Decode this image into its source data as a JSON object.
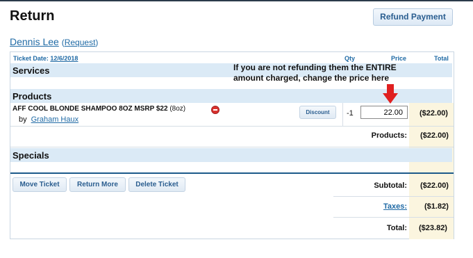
{
  "page": {
    "title": "Return"
  },
  "header": {
    "refund_button": "Refund Payment"
  },
  "customer": {
    "name": "Dennis Lee",
    "request_link": "Request"
  },
  "ticket": {
    "date_label": "Ticket Date:",
    "date_value": "12/6/2018",
    "col_qty": "Qty",
    "col_price": "Price",
    "col_total": "Total"
  },
  "sections": {
    "services": "Services",
    "products": "Products",
    "specials": "Specials"
  },
  "annotation": {
    "line1": "If you are not refunding them the ENTIRE",
    "line2": "amount charged, change the price here",
    "arrow_color": "#e02020"
  },
  "product": {
    "name": "AFF COOL BLONDE SHAMPOO 8OZ MSRP $22",
    "size": "(8oz)",
    "by_label": "by",
    "staff": "Graham Haux",
    "discount_label": "Discount",
    "qty": "-1",
    "price": "22.00",
    "total": "($22.00)"
  },
  "summary": {
    "products_label": "Products:",
    "products_value": "($22.00)",
    "subtotal_label": "Subtotal:",
    "subtotal_value": "($22.00)",
    "taxes_label": "Taxes:",
    "taxes_value": "($1.82)",
    "total_label": "Total:",
    "total_value": "($23.82)"
  },
  "actions": {
    "move": "Move Ticket",
    "return_more": "Return More",
    "delete": "Delete Ticket"
  },
  "colors": {
    "link": "#1f6aa5",
    "section_bg": "#dbeaf6",
    "total_col_bg": "#fbf5df",
    "divider": "#1c5a8a"
  }
}
